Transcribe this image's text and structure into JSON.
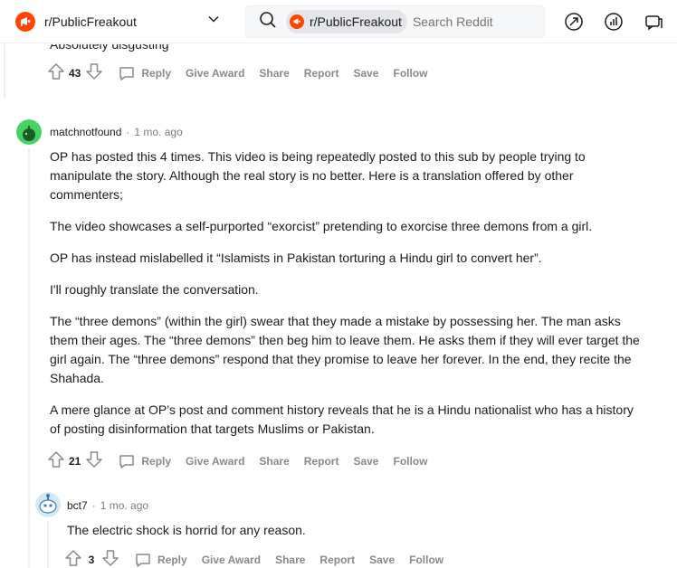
{
  "header": {
    "subreddit": "r/PublicFreakout",
    "search_chip": "r/PublicFreakout",
    "search_placeholder": "Search Reddit",
    "icons": [
      "popular-icon",
      "stats-icon",
      "mod-icon"
    ]
  },
  "comments": {
    "previous": {
      "text_fragment": "Absolutely disgusting",
      "votes": "43"
    },
    "c1": {
      "user": "matchnotfound",
      "time": "1 mo. ago",
      "paragraphs": [
        "OP has posted this 4 times. This video is being repeatedly posted to this sub by people trying to manipulate the story. Although the real story is no better. Here is a translation offered by other commenters;",
        "The video showcases a self-purported “exorcist” pretending to exorcise three demons from a girl.",
        "OP has instead mislabelled it “Islamists in Pakistan torturing a Hindu girl to convert her”.",
        "I'll roughly translate the conversation.",
        "The “three demons” (within the girl) swear that they made a mistake by possessing her. The man asks them their ages. The “three demons” then beg him to leave them. He asks them if they will ever target the girl again. The “three demons” respond that they promise to leave her forever. In the end, they recite the Shahada.",
        "A mere glance at OP’s post and comment history reveals that he is a Hindu nationalist who has a history of posting disinformation that targets Muslims or Pakistan."
      ],
      "votes": "21"
    },
    "c2": {
      "user": "bct7",
      "time": "1 mo. ago",
      "text": "The electric shock is horrid for any reason.",
      "votes": "3"
    }
  },
  "actions": {
    "reply": "Reply",
    "give_award": "Give Award",
    "share": "Share",
    "report": "Report",
    "save": "Save",
    "follow": "Follow"
  },
  "colors": {
    "brand": "#ff4500",
    "meta_gray": "#7c7c7c",
    "action_gray": "#878a8c"
  }
}
